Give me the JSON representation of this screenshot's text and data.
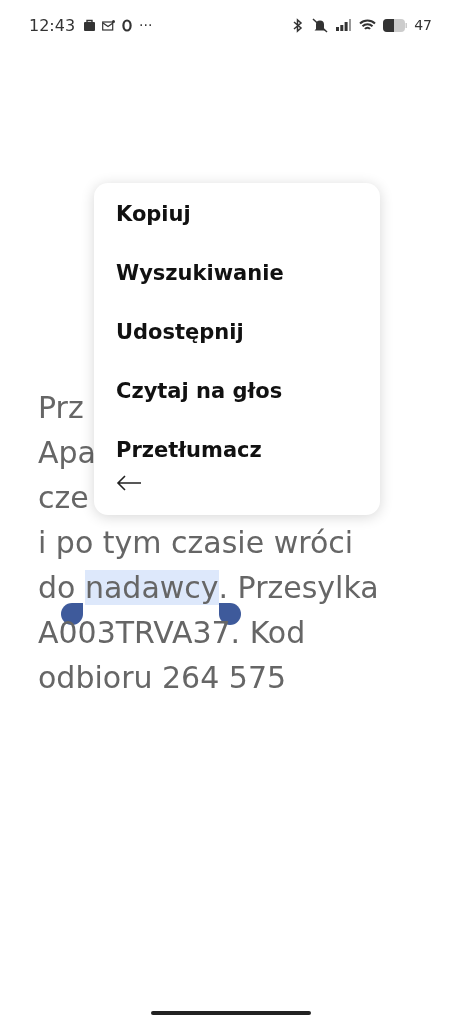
{
  "status_bar": {
    "time": "12:43",
    "more": "···",
    "battery": "47"
  },
  "message": {
    "lines": [
      [
        {
          "text": "Prz",
          "selected": false
        }
      ],
      [
        {
          "text": "Apa",
          "selected": false
        }
      ],
      [
        {
          "text": "cze",
          "selected": false
        }
      ],
      [
        {
          "text": "i po tym czasie wróci",
          "selected": false
        }
      ],
      [
        {
          "text": "do ",
          "selected": false
        },
        {
          "text": "nadawcy",
          "selected": true
        },
        {
          "text": ". Przesylka",
          "selected": false
        }
      ],
      [
        {
          "text": "A003TRVA37. Kod",
          "selected": false
        }
      ],
      [
        {
          "text": "odbioru 264 575",
          "selected": false
        }
      ]
    ]
  },
  "context_menu": {
    "items": [
      "Kopiuj",
      "Wyszukiwanie",
      "Udostępnij",
      "Czytaj na głos",
      "Przetłumacz"
    ]
  }
}
